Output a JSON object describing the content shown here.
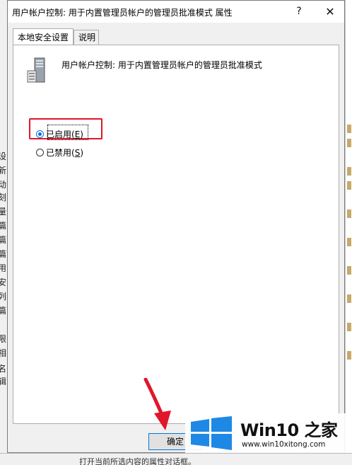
{
  "dialog": {
    "title": "用户帐户控制: 用于内置管理员帐户的管理员批准模式 属性",
    "help_glyph": "?",
    "close_glyph": "✕",
    "tabs": [
      {
        "label": "本地安全设置",
        "active": true
      },
      {
        "label": "说明",
        "active": false
      }
    ],
    "policy_name": "用户帐户控制: 用于内置管理员帐户的管理员批准模式",
    "policy_icon": "server-policy-icon",
    "options": {
      "enabled": {
        "label": "已启用(",
        "accel": "E",
        "close": ")",
        "selected": true
      },
      "disabled": {
        "label": "已禁用(",
        "accel": "S",
        "close": ")",
        "selected": false
      }
    },
    "ok_label": "确定"
  },
  "background": {
    "left_strip_chars": [
      "设",
      "新",
      "动",
      "刻",
      "量",
      "篇",
      "篇",
      "篇",
      "用",
      "安",
      "列",
      "篇",
      "限",
      "相",
      "名",
      "辑"
    ],
    "bottom_text": "打开当前所选内容的属性对话框。"
  },
  "annotation": {
    "highlight_color": "#e0162b",
    "arrow_color": "#e0162b"
  },
  "watermark": {
    "brand": "Win10 之家",
    "url": "www.win10xitong.com",
    "logo_color": "#1e88e5"
  }
}
